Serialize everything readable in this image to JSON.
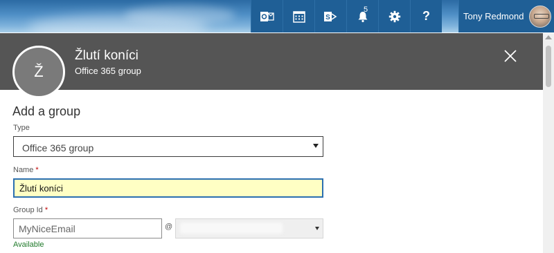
{
  "suite_bar": {
    "buttons": [
      {
        "name": "outlook-icon"
      },
      {
        "name": "calendar-icon"
      },
      {
        "name": "sharepoint-icon"
      },
      {
        "name": "bell-icon",
        "badge": "5"
      },
      {
        "name": "gear-icon"
      },
      {
        "name": "help-icon",
        "glyph": "?"
      }
    ],
    "user_name": "Tony Redmond"
  },
  "panel": {
    "avatar_letter": "Ž",
    "title": "Žlutí koníci",
    "subtitle": "Office 365 group"
  },
  "form": {
    "heading": "Add a group",
    "type_label": "Type",
    "type_value": "Office 365 group",
    "name_label": "Name",
    "name_required": "*",
    "name_value": "Žlutí koníci",
    "group_id_label": "Group Id",
    "group_id_required": "*",
    "group_id_placeholder": "MyNiceEmail",
    "at_sign": "@",
    "status_text": "Available"
  },
  "colors": {
    "suite_button": "#1f5f96",
    "panel_header": "#555555",
    "name_highlight": "#ffffc4",
    "focus_border": "#2b6fb0",
    "available_green": "#1f7a2a",
    "required_red": "#c00000"
  }
}
